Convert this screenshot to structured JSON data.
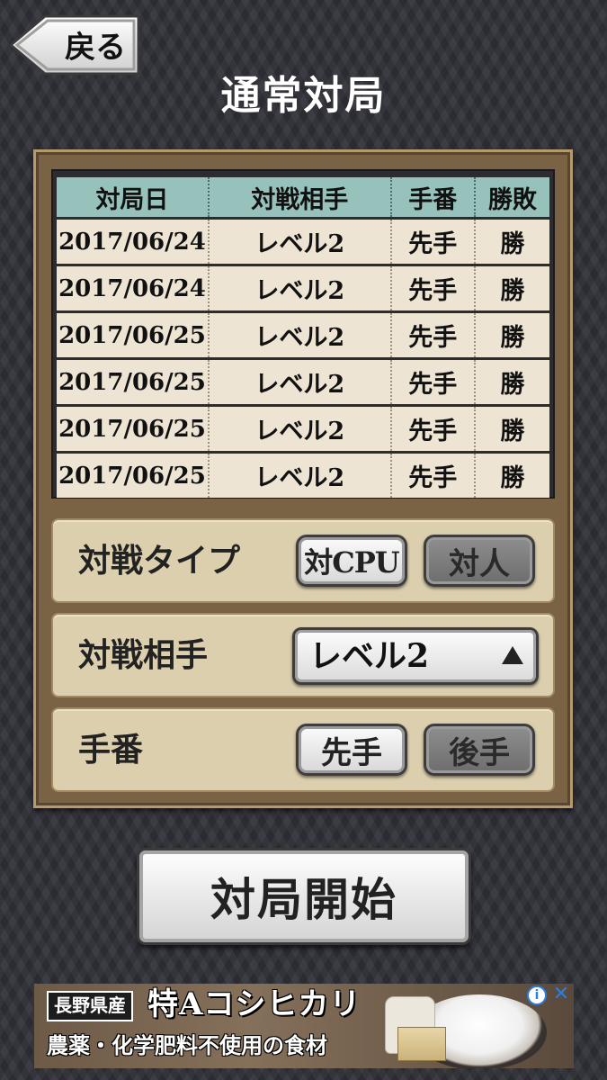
{
  "header": {
    "back_label": "戻る",
    "title": "通常対局"
  },
  "history": {
    "columns": [
      "対局日",
      "対戦相手",
      "手番",
      "勝敗"
    ],
    "rows": [
      {
        "date": "2017/06/24",
        "opponent": "レベル2",
        "turn": "先手",
        "result": "勝"
      },
      {
        "date": "2017/06/24",
        "opponent": "レベル2",
        "turn": "先手",
        "result": "勝"
      },
      {
        "date": "2017/06/25",
        "opponent": "レベル2",
        "turn": "先手",
        "result": "勝"
      },
      {
        "date": "2017/06/25",
        "opponent": "レベル2",
        "turn": "先手",
        "result": "勝"
      },
      {
        "date": "2017/06/25",
        "opponent": "レベル2",
        "turn": "先手",
        "result": "勝"
      },
      {
        "date": "2017/06/25",
        "opponent": "レベル2",
        "turn": "先手",
        "result": "勝"
      }
    ]
  },
  "options": {
    "match_type": {
      "label": "対戦タイプ",
      "choices": [
        "対CPU",
        "対人"
      ],
      "selected": "対CPU"
    },
    "opponent": {
      "label": "対戦相手",
      "value": "レベル2",
      "arrow_icon": "triangle-up-icon"
    },
    "turn": {
      "label": "手番",
      "choices": [
        "先手",
        "後手"
      ],
      "selected": "先手"
    }
  },
  "start_button": {
    "label": "対局開始"
  },
  "ad": {
    "tag": "長野県産",
    "headline": "特Aコシヒカリ",
    "sub": "農薬・化学肥料不使用の食材",
    "info_icon": "info-icon",
    "close_icon": "close-icon"
  },
  "colors": {
    "table_header": "#96c2bb",
    "table_cell": "#ede4d3",
    "panel_frame": "#7a6344",
    "option_row": "#dccfae"
  }
}
